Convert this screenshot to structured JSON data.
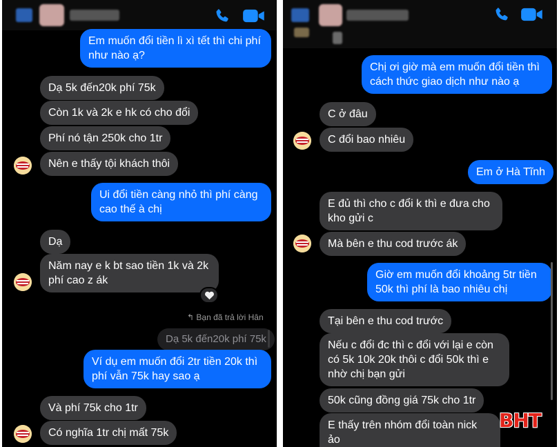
{
  "left": {
    "header": {
      "contact_name": ""
    },
    "messages": [
      "Em muốn đổi tiền lì xì tết thì chi phí\nnhư nào ạ?",
      "Dạ 5k đến20k phí 75k",
      "Còn 1k và 2k e hk có cho đổi",
      "Phí nó tận 250k cho 1tr",
      "Nên e thấy tội khách thôi",
      "Ui đổi tiền càng nhỏ thì phí càng\ncao thế à chị",
      "Dạ",
      "Năm nay e k bt sao tiền 1k và 2k\nphí cao z ák",
      "Ví dụ em muốn đổi 2tr tiền 20k thì\nphí vẫn 75k hay sao ạ",
      "Và phí 75k cho 1tr",
      "Có nghĩa 1tr chị mất 75k"
    ],
    "reply_note": "Bạn đã trả lời Hân",
    "quoted": "Dạ 5k đến20k phí 75k",
    "reaction": "white-heart"
  },
  "right": {
    "header": {
      "contact_name": ""
    },
    "messages": [
      "Chị ơi giờ mà em muốn đổi tiền thì\ncách thức giao dịch như nào ạ",
      "C ở đâu",
      "C đổi bao nhiêu",
      "Em ở Hà Tĩnh",
      "E đủ thì cho c đổi k thì e đưa cho\nkho gửi c",
      "Mà bên e thu cod trước ák",
      "Giờ em muốn đổi khoảng 5tr tiền\n50k thì phí là bao nhiêu chị",
      "Tại  bên e thu cod trước",
      "Nếu c đổi đc thì c đổi  với lại e còn\ncó 5k 10k 20k thôi c đổi 50k thì e\nnhờ chị bạn gửi",
      "50k cũng đồng giá 75k cho 1tr",
      "E thấy trên nhóm đổi toàn nick ảo\nk àk"
    ]
  },
  "watermark": "BHT",
  "icons": {
    "call": "phone-icon",
    "video": "video-camera-icon"
  },
  "colors": {
    "incoming": "#3a3a3c",
    "outgoing": "#0a6cff",
    "icon": "#1a8cff",
    "watermark": "#e2231a"
  }
}
